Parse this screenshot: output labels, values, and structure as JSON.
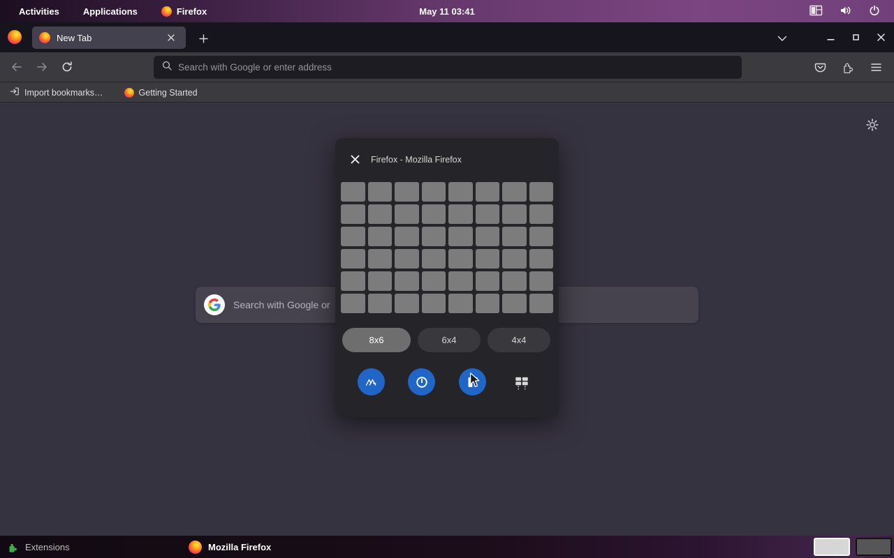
{
  "colors": {
    "accent_blue": "#2066c8",
    "grid_cell_grey": "#7c7c7c",
    "selected_button_grey": "#6e6e6e",
    "topbar_purple": "#6d3b72",
    "extensions_green": "#3fae49"
  },
  "topbar": {
    "activities_label": "Activities",
    "applications_label": "Applications",
    "app_menu_label": "Firefox",
    "clock": "May 11 03:41"
  },
  "firefox": {
    "tab_title": "New Tab",
    "url_placeholder": "Search with Google or enter address",
    "bookmarks": {
      "import_label": "Import bookmarks…",
      "getting_started_label": "Getting Started"
    },
    "newtab_search_text": "Search with Google or"
  },
  "dialog": {
    "title": "Firefox - Mozilla Firefox",
    "grid": {
      "rows": 6,
      "cols": 8
    },
    "size_buttons": [
      {
        "label": "8x6",
        "selected": true
      },
      {
        "label": "6x4",
        "selected": false
      },
      {
        "label": "4x4",
        "selected": false
      }
    ]
  },
  "taskbar": {
    "extensions_label": "Extensions",
    "window_label": "Mozilla Firefox",
    "workspace_count": 2
  }
}
